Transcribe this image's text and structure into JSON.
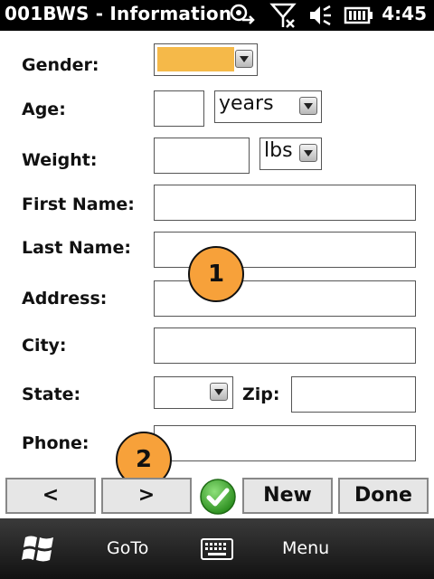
{
  "titlebar": {
    "app_title": "001BWS - Information",
    "time": "4:45",
    "icons": [
      "sync-icon",
      "signal-off-icon",
      "speaker-icon",
      "battery-icon"
    ]
  },
  "form": {
    "gender": {
      "label": "Gender:",
      "value": "",
      "highlight_color": "#f5b949"
    },
    "age": {
      "label": "Age:",
      "value": "",
      "unit": "years"
    },
    "weight": {
      "label": "Weight:",
      "value": "",
      "unit": "lbs"
    },
    "first_name": {
      "label": "First Name:",
      "value": ""
    },
    "last_name": {
      "label": "Last Name:",
      "value": ""
    },
    "address": {
      "label": "Address:",
      "value": ""
    },
    "city": {
      "label": "City:",
      "value": ""
    },
    "state": {
      "label": "State:",
      "value": ""
    },
    "zip": {
      "label": "Zip:",
      "value": ""
    },
    "phone": {
      "label": "Phone:",
      "value": ""
    }
  },
  "callouts": [
    "1",
    "2"
  ],
  "buttons": {
    "prev": "<",
    "next": ">",
    "new": "New",
    "done": "Done"
  },
  "softkeys": {
    "goto": "GoTo",
    "menu": "Menu"
  },
  "colors": {
    "callout": "#f7a13a",
    "ok_green": "#3aa12e"
  }
}
